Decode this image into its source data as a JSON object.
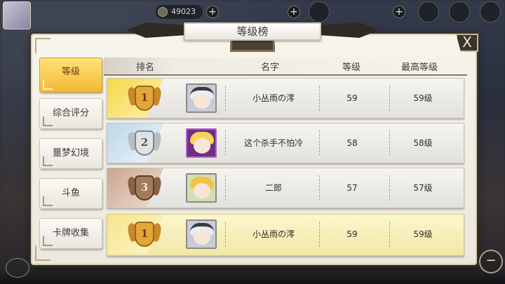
{
  "hud": {
    "currency_value": "49023",
    "plus_symbol": "+"
  },
  "panel": {
    "title": "等级榜",
    "close_symbol": "X"
  },
  "tabs": [
    {
      "label": "等级",
      "active": true
    },
    {
      "label": "综合评分",
      "active": false
    },
    {
      "label": "噩梦幻境",
      "active": false
    },
    {
      "label": "斗鱼",
      "active": false
    },
    {
      "label": "卡牌收集",
      "active": false
    }
  ],
  "table": {
    "headers": {
      "rank": "排名",
      "name": "名字",
      "level": "等级",
      "max_level": "最高等级"
    },
    "rows": [
      {
        "rank": "1",
        "name": "小丛雨の澪",
        "level": "59",
        "max_level": "59级",
        "medal": "gold-medal-icon",
        "avatar": "white-hair-girl-avatar"
      },
      {
        "rank": "2",
        "name": "这个杀手不怕冷",
        "level": "58",
        "max_level": "58级",
        "medal": "silver-medal-icon",
        "avatar": "blonde-girl-avatar"
      },
      {
        "rank": "3",
        "name": "二郎",
        "level": "57",
        "max_level": "57级",
        "medal": "bronze-medal-icon",
        "avatar": "yellow-hair-boy-avatar"
      }
    ],
    "self_row": {
      "rank": "1",
      "name": "小丛雨の澪",
      "level": "59",
      "max_level": "59级",
      "medal": "gold-medal-icon",
      "avatar": "white-hair-girl-avatar"
    }
  },
  "colors": {
    "gold": "#e3a63a",
    "silver": "#dfe3e6",
    "bronze": "#a37a5b",
    "active_tab": "#f2b935",
    "self_row": "#f1e8a6"
  }
}
